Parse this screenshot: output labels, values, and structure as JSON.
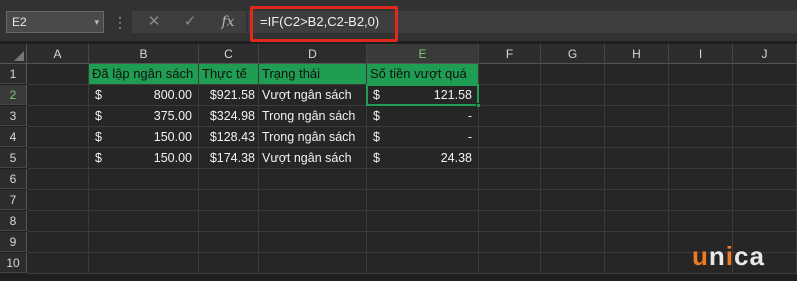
{
  "formula_bar": {
    "name_box": "E2",
    "name_box_dropdown": "▾",
    "more": "⋮",
    "cancel_icon": "✕",
    "enter_icon": "✓",
    "fx_label": "fx",
    "formula": "=IF(C2>B2,C2-B2,0)"
  },
  "columns": [
    "A",
    "B",
    "C",
    "D",
    "E",
    "F",
    "G",
    "H",
    "I",
    "J"
  ],
  "rows": [
    "1",
    "2",
    "3",
    "4",
    "5",
    "6",
    "7",
    "8",
    "9",
    "10"
  ],
  "headers": {
    "b": "Đã lập ngân sách",
    "c": "Thực tế",
    "d": "Trạng thái",
    "e": "Số tiền vượt quá"
  },
  "data_rows": [
    {
      "b_cur": "$",
      "b_val": "800.00",
      "c_val": "$921.58",
      "d": "Vượt ngân sách",
      "e_cur": "$",
      "e_val": "121.58"
    },
    {
      "b_cur": "$",
      "b_val": "375.00",
      "c_val": "$324.98",
      "d": "Trong ngân sách",
      "e_cur": "$",
      "e_val": "-"
    },
    {
      "b_cur": "$",
      "b_val": "150.00",
      "c_val": "$128.43",
      "d": "Trong ngân sách",
      "e_cur": "$",
      "e_val": "-"
    },
    {
      "b_cur": "$",
      "b_val": "150.00",
      "c_val": "$174.38",
      "d": "Vượt ngân sách",
      "e_cur": "$",
      "e_val": "24.38"
    }
  ],
  "logo": {
    "u": "u",
    "rest1": "n",
    "i": "i",
    "rest2": "ca"
  },
  "colors": {
    "header_green": "#1f9d53",
    "highlight_red": "#e0281e",
    "brand_orange": "#f07a20"
  }
}
